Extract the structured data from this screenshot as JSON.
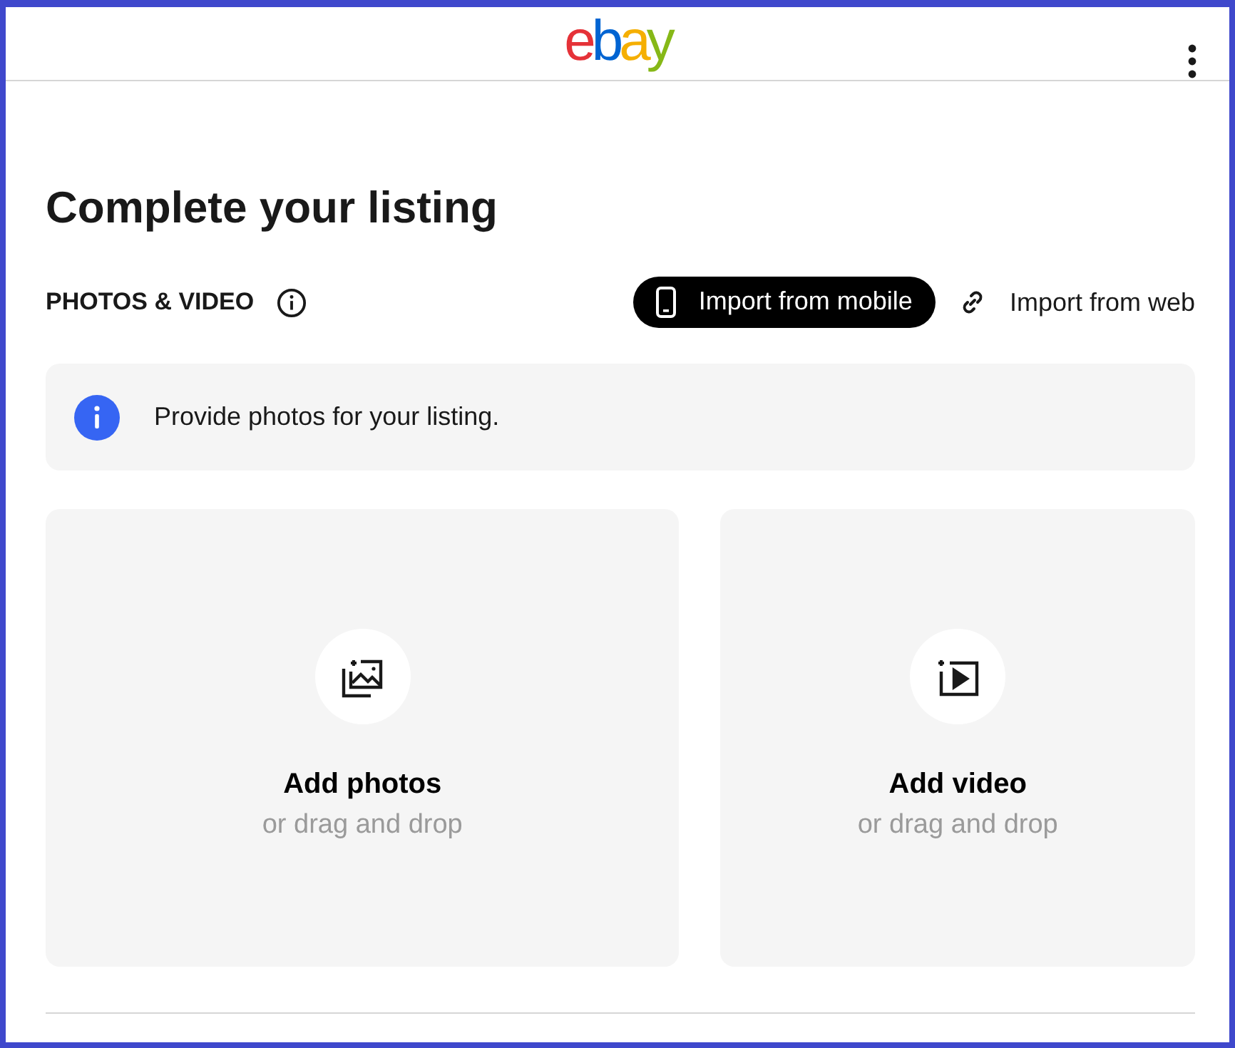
{
  "header": {
    "logo": "ebay"
  },
  "page_title": "Complete your listing",
  "section": {
    "title": "PHOTOS & VIDEO",
    "actions": [
      {
        "label": "Import from mobile",
        "kind": "primary"
      },
      {
        "label": "Import from web",
        "kind": "link"
      }
    ]
  },
  "notice": {
    "text": "Provide photos for your listing."
  },
  "upload_tiles": [
    {
      "kind": "photos",
      "title": "Add photos",
      "hint": "or drag and drop"
    },
    {
      "kind": "video",
      "title": "Add video",
      "hint": "or drag and drop"
    }
  ]
}
